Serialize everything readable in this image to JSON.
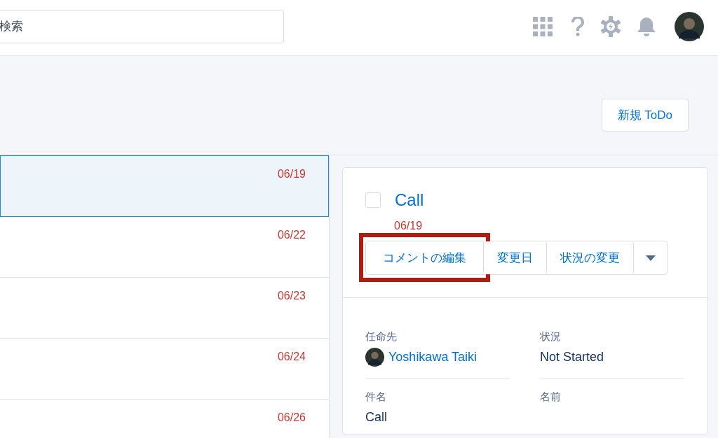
{
  "header": {
    "search": {
      "placeholder": "検索"
    }
  },
  "page_header": {
    "new_button": "新規 ToDo"
  },
  "task_list": [
    {
      "date": "06/19",
      "selected": true
    },
    {
      "date": "06/22",
      "selected": false
    },
    {
      "date": "06/23",
      "selected": false
    },
    {
      "date": "06/24",
      "selected": false
    },
    {
      "date": "06/26",
      "selected": false
    }
  ],
  "detail": {
    "checked": false,
    "title": "Call",
    "date": "06/19",
    "actions": [
      {
        "label": "コメントの編集",
        "highlighted": true
      },
      {
        "label": "変更日",
        "highlighted": false
      },
      {
        "label": "状況の変更",
        "highlighted": false
      }
    ],
    "fields": [
      {
        "label": "任命先",
        "value": "Yoshikawa Taiki",
        "kind": "user"
      },
      {
        "label": "状況",
        "value": "Not Started",
        "kind": "text"
      },
      {
        "label": "件名",
        "value": "Call",
        "kind": "text"
      },
      {
        "label": "名前"
      }
    ]
  }
}
